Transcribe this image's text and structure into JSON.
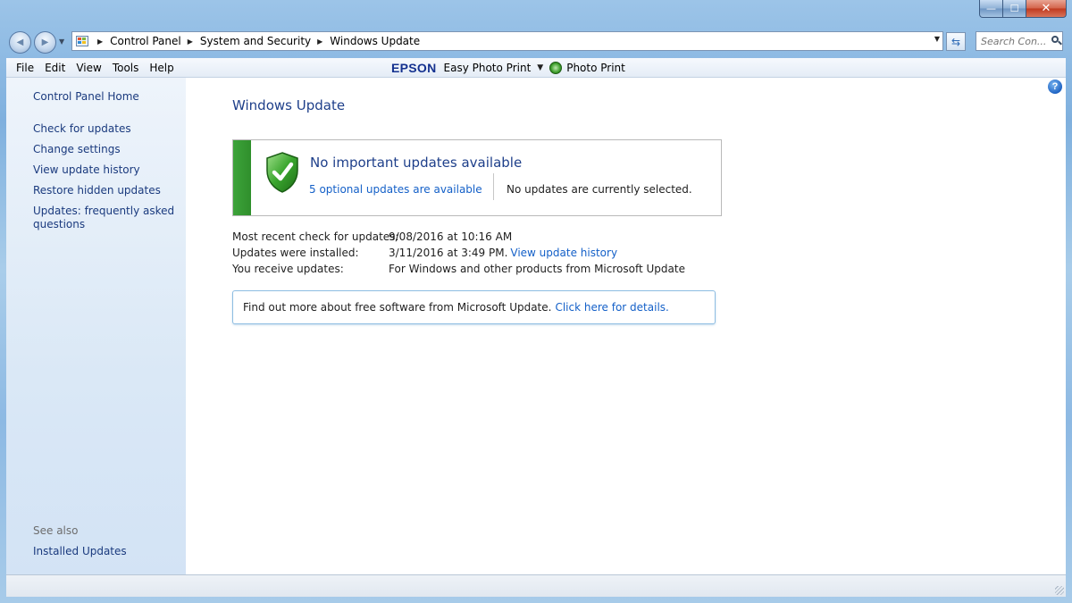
{
  "window": {
    "caption": {
      "minimize": "—",
      "maximize": "☐",
      "close": "✕"
    }
  },
  "navigation": {
    "back_glyph": "◀",
    "forward_glyph": "▶",
    "recent_glyph": "▼",
    "breadcrumbs": [
      "Control Panel",
      "System and Security",
      "Windows Update"
    ],
    "separator_glyph": "▶",
    "dropdown_glyph": "▼",
    "refresh_glyph": "⇆",
    "search_placeholder": "Search Con..."
  },
  "menu": {
    "items": [
      "File",
      "Edit",
      "View",
      "Tools",
      "Help"
    ],
    "epson": {
      "logo": "EPSON",
      "easy_photo_print": "Easy Photo Print",
      "dropdown_glyph": "▼",
      "photo_print": "Photo Print"
    }
  },
  "sidebar": {
    "home": "Control Panel Home",
    "links": [
      "Check for updates",
      "Change settings",
      "View update history",
      "Restore hidden updates",
      "Updates: frequently asked questions"
    ],
    "see_also_heading": "See also",
    "see_also_links": [
      "Installed Updates"
    ]
  },
  "main": {
    "help_glyph": "?",
    "title": "Windows Update",
    "status": {
      "heading": "No important updates available",
      "optional_link": "5 optional updates are available",
      "selected_text": "No updates are currently selected.",
      "accent_color": "#3da33a"
    },
    "info": {
      "recent_check_label": "Most recent check for updates:",
      "recent_check_value": "9/08/2016 at 10:16 AM",
      "installed_label": "Updates were installed:",
      "installed_value": "3/11/2016 at 3:49 PM.",
      "installed_link": "View update history",
      "receive_label": "You receive updates:",
      "receive_value": "For Windows and other products from Microsoft Update"
    },
    "free_software": {
      "text": "Find out more about free software from Microsoft Update.",
      "link": "Click here for details."
    }
  }
}
